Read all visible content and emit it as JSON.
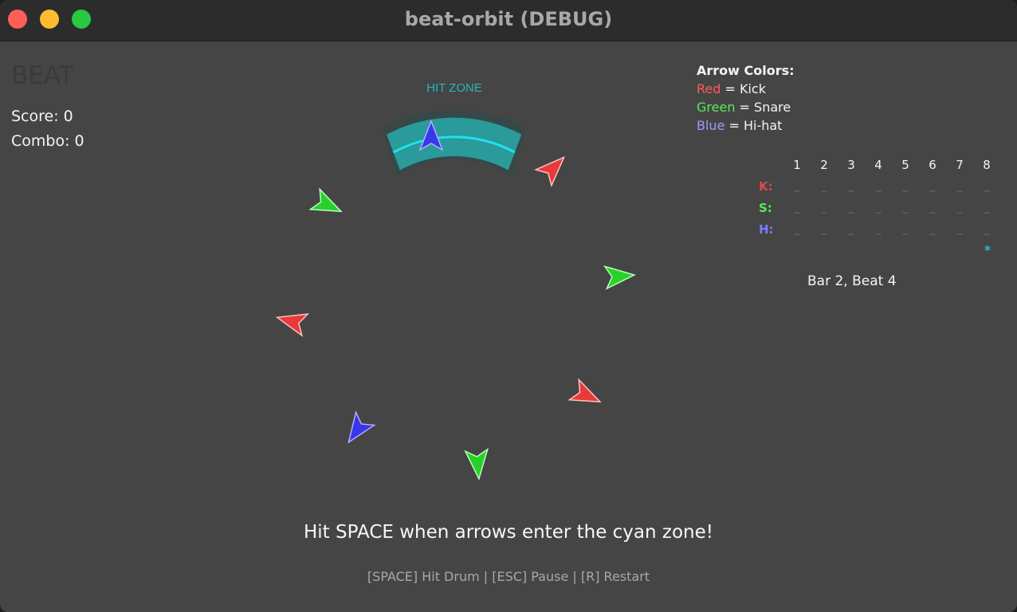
{
  "window": {
    "title": "beat-orbit (DEBUG)"
  },
  "hud": {
    "beat_label": "BEAT",
    "score_text": "Score: 0",
    "combo_text": "Combo: 0",
    "hit_zone_label": "HIT ZONE",
    "instruction": "Hit SPACE when arrows enter the cyan zone!",
    "controls": "[SPACE] Hit Drum | [ESC] Pause | [R] Restart"
  },
  "legend": {
    "title": "Arrow Colors:",
    "items": [
      {
        "color_name": "Red",
        "meaning": " = Kick",
        "color": "#ff5a5a"
      },
      {
        "color_name": "Green",
        "meaning": " = Snare",
        "color": "#55ee55"
      },
      {
        "color_name": "Blue",
        "meaning": " = Hi-hat",
        "color": "#9a9aff"
      }
    ]
  },
  "sequencer": {
    "steps": [
      "1",
      "2",
      "3",
      "4",
      "5",
      "6",
      "7",
      "8"
    ],
    "rows": [
      {
        "label": "K:",
        "color": "#e04848",
        "cells": [
          "_",
          "_",
          "_",
          "_",
          "_",
          "_",
          "_",
          "_"
        ]
      },
      {
        "label": "S:",
        "color": "#55ee55",
        "cells": [
          "_",
          "_",
          "_",
          "_",
          "_",
          "_",
          "_",
          "_"
        ]
      },
      {
        "label": "H:",
        "color": "#7a7aff",
        "cells": [
          "_",
          "_",
          "_",
          "_",
          "_",
          "_",
          "_",
          "_"
        ]
      }
    ],
    "current_step_marker": "*",
    "position_text": "Bar 2, Beat 4"
  },
  "arrows": [
    {
      "drum": "hi-hat",
      "color": "blue"
    },
    {
      "drum": "kick",
      "color": "red"
    },
    {
      "drum": "snare",
      "color": "green"
    },
    {
      "drum": "snare",
      "color": "green"
    },
    {
      "drum": "kick",
      "color": "red"
    },
    {
      "drum": "kick",
      "color": "red"
    },
    {
      "drum": "hi-hat",
      "color": "blue"
    },
    {
      "drum": "snare",
      "color": "green"
    }
  ],
  "colors": {
    "background": "#454545",
    "hit_zone": "#2a9a9a",
    "hit_zone_line": "#22e0ee",
    "accent": "#2ab5b5"
  }
}
